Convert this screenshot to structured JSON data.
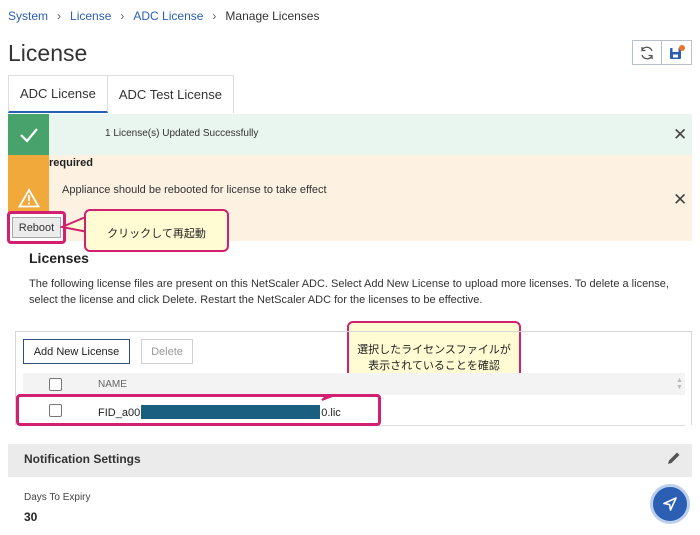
{
  "breadcrumb": {
    "items": [
      "System",
      "License",
      "ADC License"
    ],
    "current": "Manage Licenses"
  },
  "page": {
    "title": "License"
  },
  "toolbar": {
    "refresh_icon": "refresh-icon",
    "save_icon": "save-icon"
  },
  "tabs": [
    {
      "label": "ADC License",
      "active": true
    },
    {
      "label": "ADC Test License",
      "active": false
    }
  ],
  "success_banner": {
    "message": "1 License(s) Updated Successfully",
    "color": "#48a26c"
  },
  "warning_banner": {
    "title": "required",
    "message": "Appliance should be rebooted for license to take effect",
    "reboot_label": "Reboot",
    "color": "#f2a93b"
  },
  "callouts": {
    "reboot": "クリックして再起動",
    "file_line1": "選択したライセンスファイルが",
    "file_line2": "表示されていることを確認"
  },
  "licenses": {
    "title": "Licenses",
    "description": "The following license files are present on this NetScaler ADC. Select Add New License to upload more licenses. To delete a license, select the license and click Delete. Restart the NetScaler ADC for the licenses to be effective.",
    "add_label": "Add New License",
    "delete_label": "Delete",
    "column_name": "NAME",
    "rows": [
      {
        "prefix": "FID_a00",
        "suffix": "0.lic",
        "checked": false
      }
    ]
  },
  "notification": {
    "title": "Notification Settings",
    "days_label": "Days To Expiry",
    "days_value": "30"
  },
  "colors": {
    "accent": "#2b5fb3",
    "highlight": "#d21f6f",
    "callout_bg": "#fffcd3"
  }
}
